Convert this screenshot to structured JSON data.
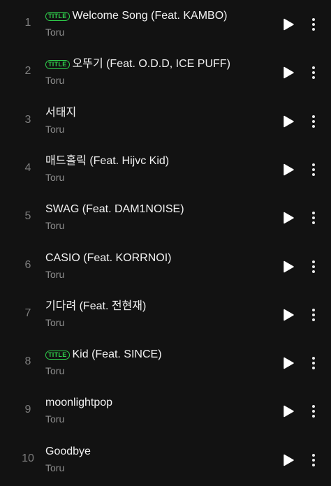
{
  "badge_label": "TITLE",
  "colors": {
    "background": "#121212",
    "badge_accent": "#2fd14c",
    "title_text": "#f2f2f2",
    "secondary_text": "#8e8e8e",
    "number_text": "#7d7d7d"
  },
  "icons": {
    "play": "play-icon",
    "more": "more-vertical-icon"
  },
  "tracks": [
    {
      "number": "1",
      "title": "Welcome Song (Feat. KAMBO)",
      "artist": "Toru",
      "is_title": true
    },
    {
      "number": "2",
      "title": "오뚜기 (Feat. O.D.D, ICE PUFF)",
      "artist": "Toru",
      "is_title": true
    },
    {
      "number": "3",
      "title": "서태지",
      "artist": "Toru",
      "is_title": false
    },
    {
      "number": "4",
      "title": "매드홀릭 (Feat. Hijvc Kid)",
      "artist": "Toru",
      "is_title": false
    },
    {
      "number": "5",
      "title": "SWAG (Feat. DAM1NOISE)",
      "artist": "Toru",
      "is_title": false
    },
    {
      "number": "6",
      "title": "CASIO (Feat. KORRNOI)",
      "artist": "Toru",
      "is_title": false
    },
    {
      "number": "7",
      "title": "기다려 (Feat. 전현재)",
      "artist": "Toru",
      "is_title": false
    },
    {
      "number": "8",
      "title": "Kid (Feat. SINCE)",
      "artist": "Toru",
      "is_title": true
    },
    {
      "number": "9",
      "title": "moonlightpop",
      "artist": "Toru",
      "is_title": false
    },
    {
      "number": "10",
      "title": "Goodbye",
      "artist": "Toru",
      "is_title": false
    }
  ]
}
